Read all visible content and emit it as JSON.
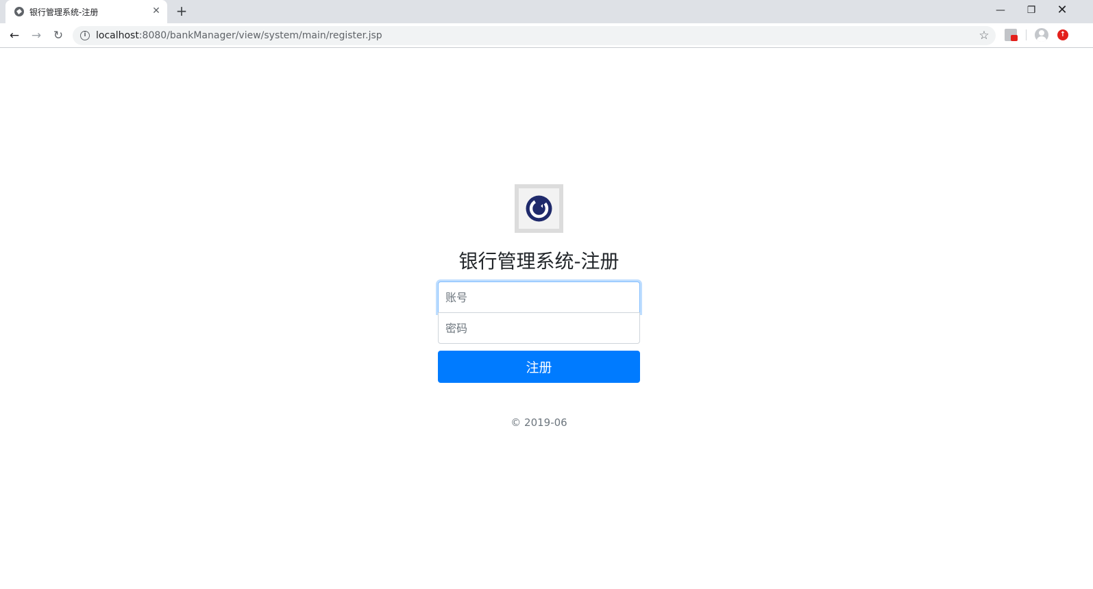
{
  "browser": {
    "tab_title": "银行管理系统-注册",
    "url_host": "localhost",
    "url_rest": ":8080/bankManager/view/system/main/register.jsp",
    "icons": {
      "favicon": "globe-icon",
      "tab_close": "close-icon",
      "new_tab": "plus-icon",
      "back": "arrow-left-icon",
      "forward": "arrow-right-icon",
      "reload": "reload-icon",
      "site_info": "info-icon",
      "bookmark": "star-icon",
      "extension": "extension-icon",
      "profile": "avatar-icon",
      "update": "update-icon"
    },
    "glyphs": {
      "tab_close": "✕",
      "new_tab": "+",
      "back": "←",
      "forward": "→",
      "reload": "↻",
      "site_info": "i",
      "bookmark": "☆",
      "minimize": "—",
      "maximize": "❐",
      "close": "✕",
      "update": "↑"
    }
  },
  "page": {
    "title": "银行管理系统-注册",
    "account_placeholder": "账号",
    "password_placeholder": "密码",
    "submit_label": "注册",
    "footer": "© 2019-06",
    "colors": {
      "primary": "#007bff",
      "logo": "#1f2a6b"
    }
  }
}
